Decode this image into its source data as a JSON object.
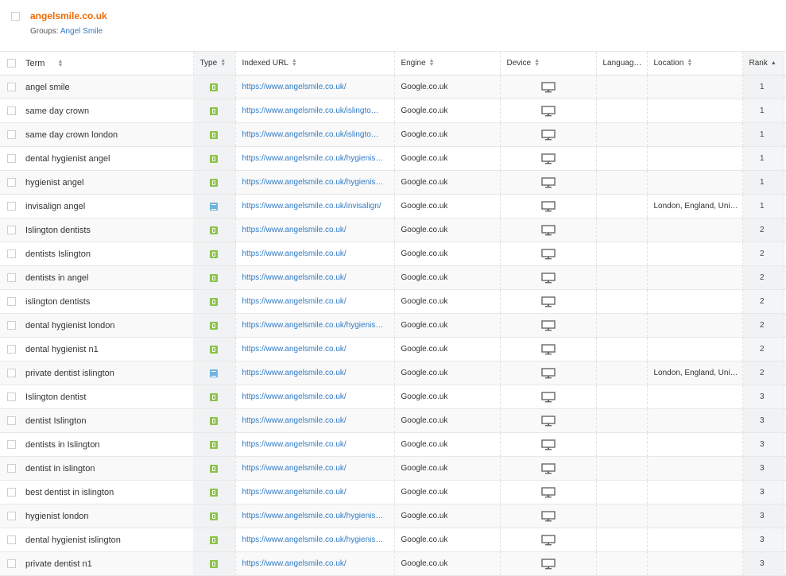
{
  "header": {
    "site": "angelsmile.co.uk",
    "groups_label": "Groups:",
    "group_link": "Angel Smile"
  },
  "columns": {
    "term": "Term",
    "type": "Type",
    "indexed_url": "Indexed URL",
    "engine": "Engine",
    "device": "Device",
    "language": "Languag…",
    "location": "Location",
    "rank": "Rank"
  },
  "icons": {
    "organic": "organic-result-icon",
    "local": "local-pack-icon",
    "device": "desktop-monitor-icon",
    "sort": "sort-arrows-icon"
  },
  "colors": {
    "site_title": "#f06a00",
    "link": "#2f7bc5",
    "organic": "#8bc34a",
    "local": "#6fb4dd"
  },
  "rows": [
    {
      "term": "angel smile",
      "type": "organic",
      "url": "https://www.angelsmile.co.uk/",
      "engine": "Google.co.uk",
      "location": "",
      "rank": "1"
    },
    {
      "term": "same day crown",
      "type": "organic",
      "url": "https://www.angelsmile.co.uk/islingto…",
      "engine": "Google.co.uk",
      "location": "",
      "rank": "1"
    },
    {
      "term": "same day crown london",
      "type": "organic",
      "url": "https://www.angelsmile.co.uk/islingto…",
      "engine": "Google.co.uk",
      "location": "",
      "rank": "1"
    },
    {
      "term": "dental hygienist angel",
      "type": "organic",
      "url": "https://www.angelsmile.co.uk/hygienis…",
      "engine": "Google.co.uk",
      "location": "",
      "rank": "1"
    },
    {
      "term": "hygienist angel",
      "type": "organic",
      "url": "https://www.angelsmile.co.uk/hygienis…",
      "engine": "Google.co.uk",
      "location": "",
      "rank": "1"
    },
    {
      "term": "invisalign angel",
      "type": "local",
      "url": "https://www.angelsmile.co.uk/invisalign/",
      "engine": "Google.co.uk",
      "location": "London, England, Uni…",
      "rank": "1"
    },
    {
      "term": "Islington dentists",
      "type": "organic",
      "url": "https://www.angelsmile.co.uk/",
      "engine": "Google.co.uk",
      "location": "",
      "rank": "2"
    },
    {
      "term": "dentists Islington",
      "type": "organic",
      "url": "https://www.angelsmile.co.uk/",
      "engine": "Google.co.uk",
      "location": "",
      "rank": "2"
    },
    {
      "term": "dentists in angel",
      "type": "organic",
      "url": "https://www.angelsmile.co.uk/",
      "engine": "Google.co.uk",
      "location": "",
      "rank": "2"
    },
    {
      "term": "islington dentists",
      "type": "organic",
      "url": "https://www.angelsmile.co.uk/",
      "engine": "Google.co.uk",
      "location": "",
      "rank": "2"
    },
    {
      "term": "dental hygienist london",
      "type": "organic",
      "url": "https://www.angelsmile.co.uk/hygienis…",
      "engine": "Google.co.uk",
      "location": "",
      "rank": "2"
    },
    {
      "term": "dental hygienist n1",
      "type": "organic",
      "url": "https://www.angelsmile.co.uk/",
      "engine": "Google.co.uk",
      "location": "",
      "rank": "2"
    },
    {
      "term": "private dentist islington",
      "type": "local",
      "url": "https://www.angelsmile.co.uk/",
      "engine": "Google.co.uk",
      "location": "London, England, Uni…",
      "rank": "2"
    },
    {
      "term": "Islington dentist",
      "type": "organic",
      "url": "https://www.angelsmile.co.uk/",
      "engine": "Google.co.uk",
      "location": "",
      "rank": "3"
    },
    {
      "term": "dentist Islington",
      "type": "organic",
      "url": "https://www.angelsmile.co.uk/",
      "engine": "Google.co.uk",
      "location": "",
      "rank": "3"
    },
    {
      "term": "dentists in Islington",
      "type": "organic",
      "url": "https://www.angelsmile.co.uk/",
      "engine": "Google.co.uk",
      "location": "",
      "rank": "3"
    },
    {
      "term": "dentist in islington",
      "type": "organic",
      "url": "https://www.angelsmile.co.uk/",
      "engine": "Google.co.uk",
      "location": "",
      "rank": "3"
    },
    {
      "term": "best dentist in islington",
      "type": "organic",
      "url": "https://www.angelsmile.co.uk/",
      "engine": "Google.co.uk",
      "location": "",
      "rank": "3"
    },
    {
      "term": "hygienist london",
      "type": "organic",
      "url": "https://www.angelsmile.co.uk/hygienis…",
      "engine": "Google.co.uk",
      "location": "",
      "rank": "3"
    },
    {
      "term": "dental hygienist islington",
      "type": "organic",
      "url": "https://www.angelsmile.co.uk/hygienis…",
      "engine": "Google.co.uk",
      "location": "",
      "rank": "3"
    },
    {
      "term": "private dentist n1",
      "type": "organic",
      "url": "https://www.angelsmile.co.uk/",
      "engine": "Google.co.uk",
      "location": "",
      "rank": "3"
    }
  ]
}
